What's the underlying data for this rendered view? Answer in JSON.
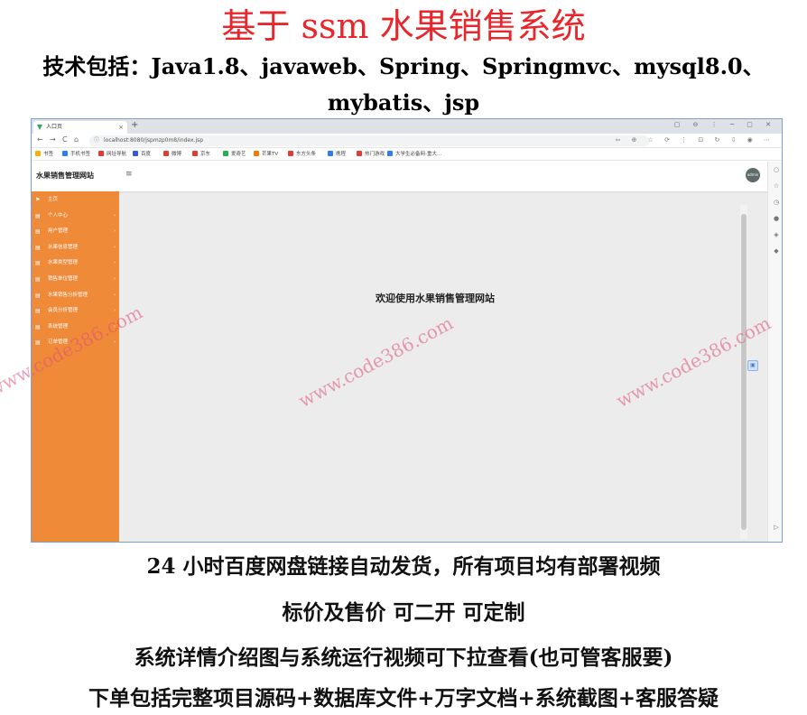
{
  "header": {
    "title": "基于 ssm 水果销售系统",
    "tech_line1": "技术包括：Java1.8、javaweb、Spring、Springmvc、mysql8.0、",
    "tech_line2": "mybatis、jsp"
  },
  "browser": {
    "tab_title": "入口页",
    "tab_close": "×",
    "new_tab": "+",
    "window_controls": "▢ ⊖ ⋮ ─ ▢ ✕",
    "nav": {
      "back": "←",
      "forward": "→",
      "reload": "C",
      "home": "⌂"
    },
    "url_info": "ⓘ",
    "url": "localhost:8080/jspmzp0m8/index.jsp",
    "addr_icons": "⇦ ⊕ ☆ ⟳ ⋮ ⊡ ↻ ⇩ ◉ ⋯",
    "bookmarks": [
      {
        "label": "书签",
        "color": "#f5b400"
      },
      {
        "label": "手机书签",
        "color": "#2f7df6"
      },
      {
        "label": "网址导航",
        "color": "#e53935"
      },
      {
        "label": "百度",
        "color": "#2f5be0"
      },
      {
        "label": "微博",
        "color": "#e53935"
      },
      {
        "label": "京东",
        "color": "#e53935"
      },
      {
        "label": "爱奇艺",
        "color": "#25b24a"
      },
      {
        "label": "芒果TV",
        "color": "#f57c00"
      },
      {
        "label": "东方头条",
        "color": "#e53935"
      },
      {
        "label": "携程",
        "color": "#2f7df6"
      },
      {
        "label": "热门游戏",
        "color": "#e53935"
      },
      {
        "label": "大学生必备网-重大...",
        "color": "#2f7df6"
      }
    ]
  },
  "app": {
    "name": "水果销售管理网站",
    "menu_toggle": "≡",
    "avatar": "admin",
    "welcome": "欢迎使用水果销售管理网站",
    "float_icon": "▣",
    "sidebar": [
      {
        "label": "主页",
        "icon": "⚑",
        "caret": ""
      },
      {
        "label": "个人中心",
        "icon": "▤",
        "caret": "›"
      },
      {
        "label": "用户管理",
        "icon": "▤",
        "caret": "›"
      },
      {
        "label": "水果信息管理",
        "icon": "▤",
        "caret": "›"
      },
      {
        "label": "水果类型管理",
        "icon": "▤",
        "caret": "›"
      },
      {
        "label": "销售单位管理",
        "icon": "▤",
        "caret": "›"
      },
      {
        "label": "水果销售分析管理",
        "icon": "▤",
        "caret": "›"
      },
      {
        "label": "会员分析管理",
        "icon": "▤",
        "caret": "›"
      },
      {
        "label": "系统管理",
        "icon": "▤",
        "caret": "›"
      },
      {
        "label": "订单管理",
        "icon": "▤",
        "caret": "›"
      }
    ],
    "rail_icons": [
      "○",
      "☆",
      "◷",
      "●",
      "◈",
      "◆",
      "▷"
    ]
  },
  "watermark": "www.code386.com",
  "footer": [
    "24 小时百度网盘链接自动发货，所有项目均有部署视频",
    "标价及售价  可二开  可定制",
    "系统详情介绍图与系统运行视频可下拉查看(也可管客服要)",
    "下单包括完整项目源码+数据库文件+万字文档+系统截图+客服答疑"
  ],
  "colors": {
    "title_red": "#e8262b",
    "sidebar_orange": "#ef8a38",
    "content_gray": "#ececec",
    "watermark_pink": "#e15078"
  }
}
